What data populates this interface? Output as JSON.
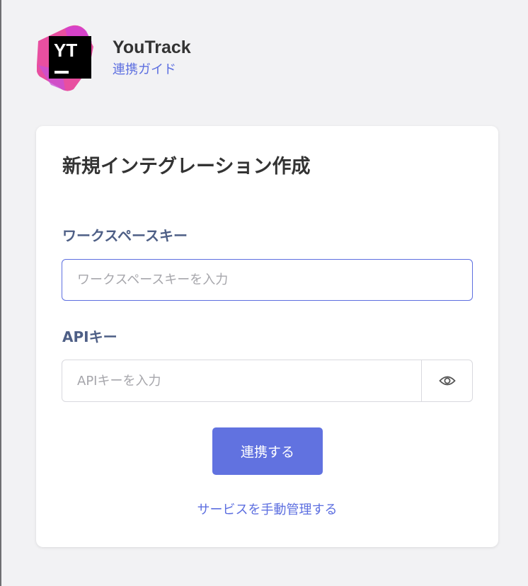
{
  "brand": {
    "name": "YouTrack",
    "logo_text": "YT",
    "guide_link": "連携ガイド"
  },
  "form": {
    "title": "新規インテグレーション作成",
    "workspace_key": {
      "label": "ワークスペースキー",
      "placeholder": "ワークスペースキーを入力",
      "value": ""
    },
    "api_key": {
      "label": "APIキー",
      "placeholder": "APIキーを入力",
      "value": "",
      "toggle_icon": "eye-icon"
    },
    "submit_label": "連携する",
    "manual_link": "サービスを手動管理する"
  },
  "colors": {
    "accent": "#5d6fe0",
    "button": "#6172e0",
    "label": "#4e5f86",
    "background": "#f2f2f4"
  }
}
